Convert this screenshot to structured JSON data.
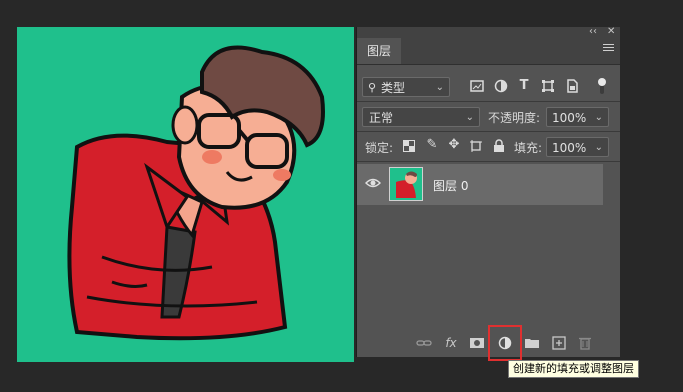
{
  "layers_panel": {
    "tab_label": "图层",
    "collapse_glyph": "‹‹",
    "close_glyph": "✕",
    "filter": {
      "label": "类型",
      "caret": "⌄"
    },
    "filter_icons": [
      "image-filter-icon",
      "adjustment-filter-icon",
      "text-filter-icon",
      "shape-filter-icon",
      "smart-object-filter-icon"
    ],
    "blend_mode": "正常",
    "opacity_label": "不透明度:",
    "opacity_value": "100%",
    "lock_label": "锁定:",
    "lock_icons": [
      "lock-transparent-icon",
      "lock-pixels-icon",
      "lock-position-icon",
      "lock-artboard-icon",
      "lock-all-icon"
    ],
    "fill_label": "填充:",
    "fill_value": "100%",
    "layers": [
      {
        "name": "图层 0",
        "visible": true,
        "selected": true
      }
    ],
    "bottom_icons": [
      "link-icon",
      "fx-icon",
      "mask-icon",
      "adjustment-layer-icon",
      "group-folder-icon",
      "new-layer-icon",
      "trash-icon"
    ],
    "fx_label": "fx"
  },
  "tooltip": "创建新的填充或调整图层",
  "colors": {
    "canvas_bg": "#1fc08c",
    "panel_bg": "#535353",
    "highlight": "#e03030"
  }
}
